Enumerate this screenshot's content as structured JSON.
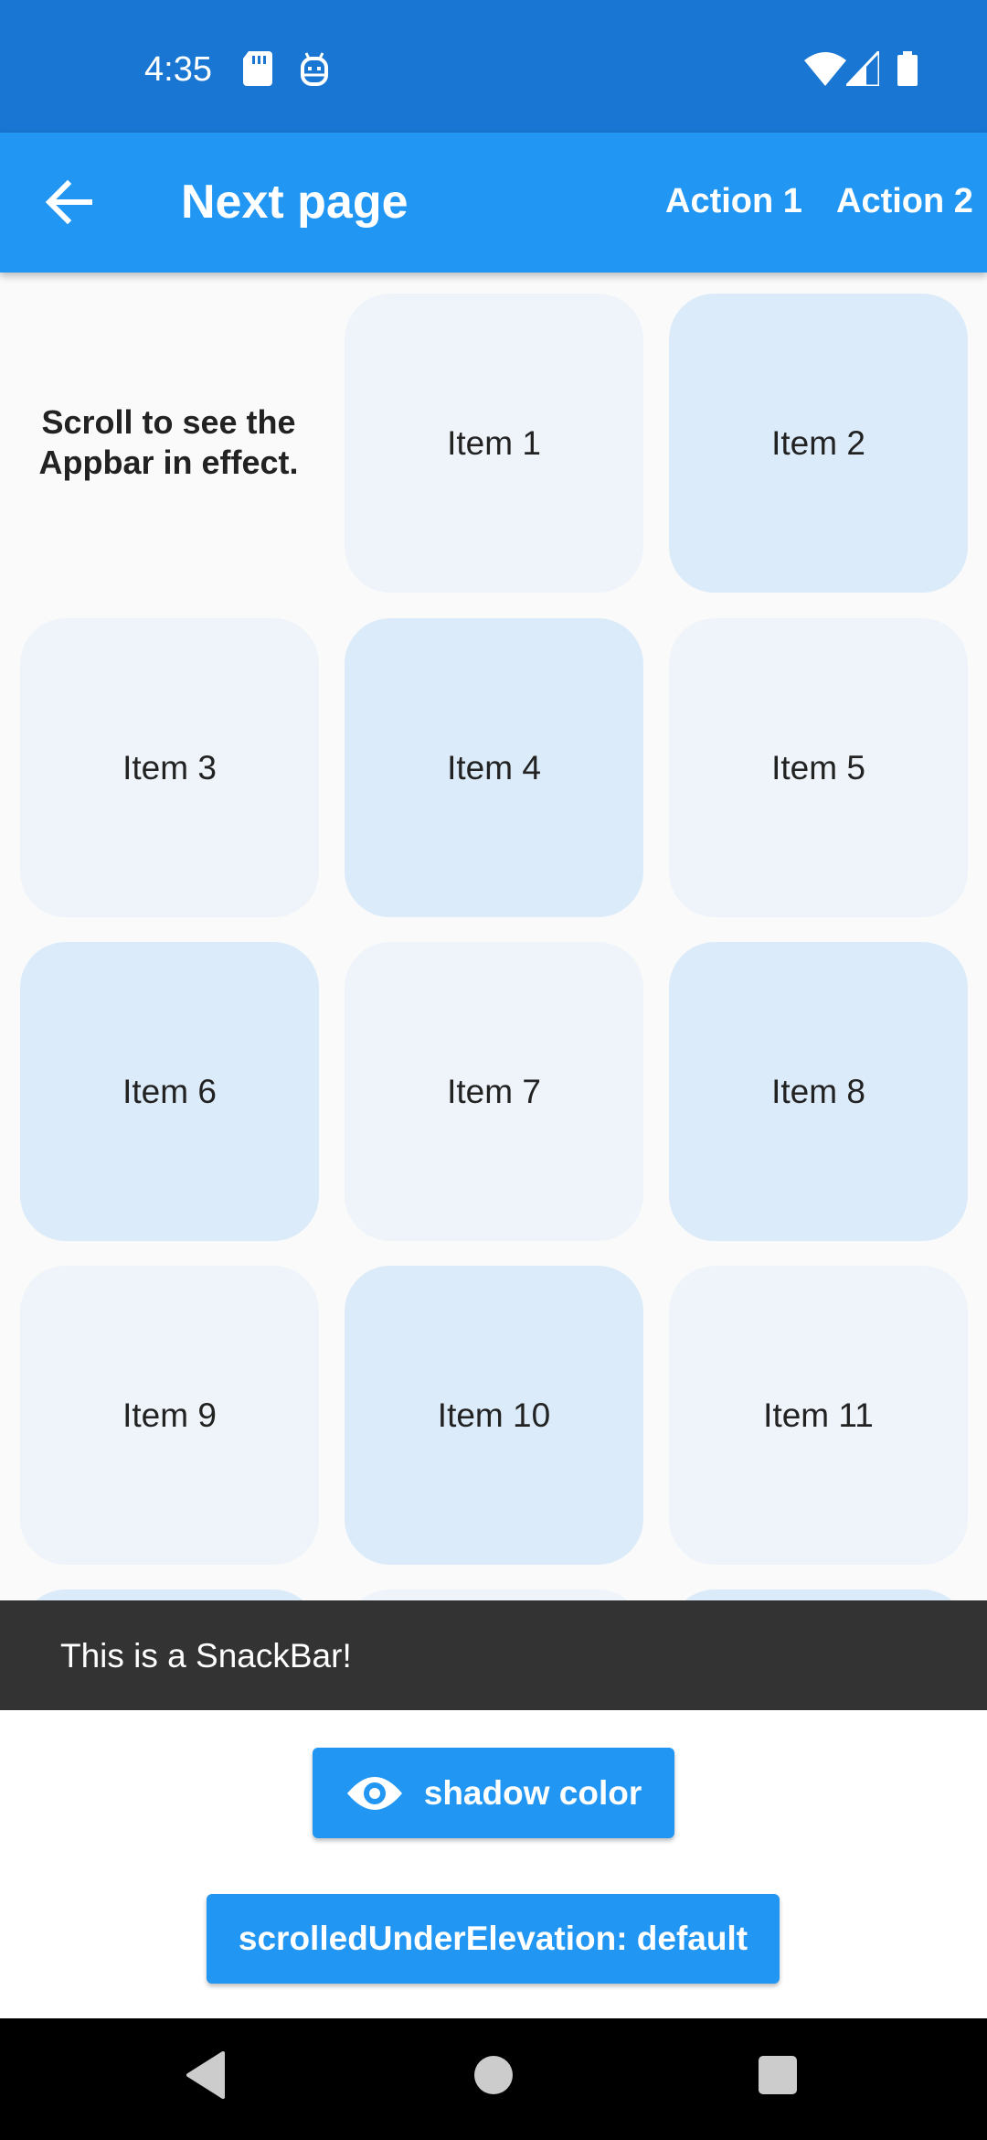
{
  "status_bar": {
    "time": "4:35",
    "left_icons": [
      "sd-card-icon",
      "android-debug-icon"
    ],
    "right_icons": [
      "wifi-icon",
      "signal-icon",
      "battery-icon"
    ]
  },
  "app_bar": {
    "title": "Next page",
    "back_icon": "arrow-back-icon",
    "actions": [
      "Action 1",
      "Action 2"
    ],
    "color": "#2196F3"
  },
  "grid": {
    "intro_text": "Scroll to see the Appbar in effect.",
    "items": [
      {
        "label": "Item 1",
        "tone": "light"
      },
      {
        "label": "Item 2",
        "tone": "blue"
      },
      {
        "label": "Item 3",
        "tone": "light"
      },
      {
        "label": "Item 4",
        "tone": "blue"
      },
      {
        "label": "Item 5",
        "tone": "light"
      },
      {
        "label": "Item 6",
        "tone": "blue"
      },
      {
        "label": "Item 7",
        "tone": "light"
      },
      {
        "label": "Item 8",
        "tone": "blue"
      },
      {
        "label": "Item 9",
        "tone": "light"
      },
      {
        "label": "Item 10",
        "tone": "blue"
      },
      {
        "label": "Item 11",
        "tone": "light"
      }
    ]
  },
  "snackbar": {
    "text": "This is a SnackBar!"
  },
  "buttons": {
    "shadow_color": {
      "label": "shadow color",
      "icon": "eye-icon"
    },
    "elevation": {
      "label": "scrolledUnderElevation: default"
    }
  },
  "nav_bar": {
    "icons": [
      "back-triangle-icon",
      "home-circle-icon",
      "recents-square-icon"
    ]
  },
  "colors": {
    "status_bar": "#1976D2",
    "tile_light": "#EEF4FA",
    "tile_blue": "#DBEBF9",
    "snackbar": "#333333"
  }
}
